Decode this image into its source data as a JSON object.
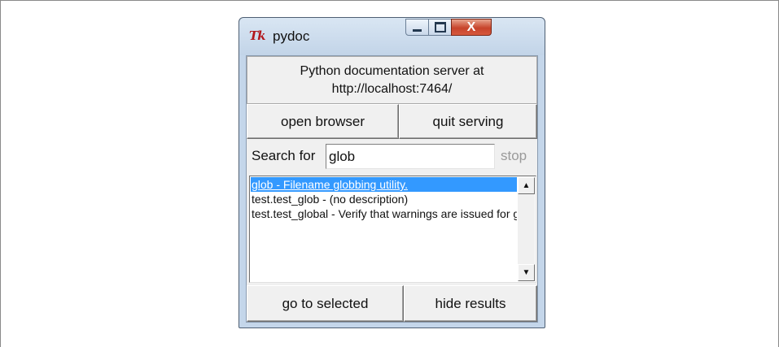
{
  "window": {
    "title": "pydoc",
    "app_icon": "Tk",
    "controls": {
      "close": "X"
    }
  },
  "server": {
    "line1": "Python documentation server at",
    "line2": "http://localhost:7464/"
  },
  "buttons": {
    "open_browser": "open browser",
    "quit_serving": "quit serving",
    "go_to_selected": "go to selected",
    "hide_results": "hide results"
  },
  "search": {
    "label": "Search for",
    "value": "glob",
    "stop_label": "stop"
  },
  "results": [
    {
      "text": "glob - Filename globbing utility.",
      "selected": true
    },
    {
      "text": "test.test_glob - (no description)",
      "selected": false
    },
    {
      "text": "test.test_global - Verify that warnings are issued for global statements following use.",
      "selected": false
    }
  ],
  "colors": {
    "selection": "#3399ff",
    "title_bar": "#c4d6ea",
    "close_button": "#c7442b",
    "tk_icon": "#b3171c"
  }
}
